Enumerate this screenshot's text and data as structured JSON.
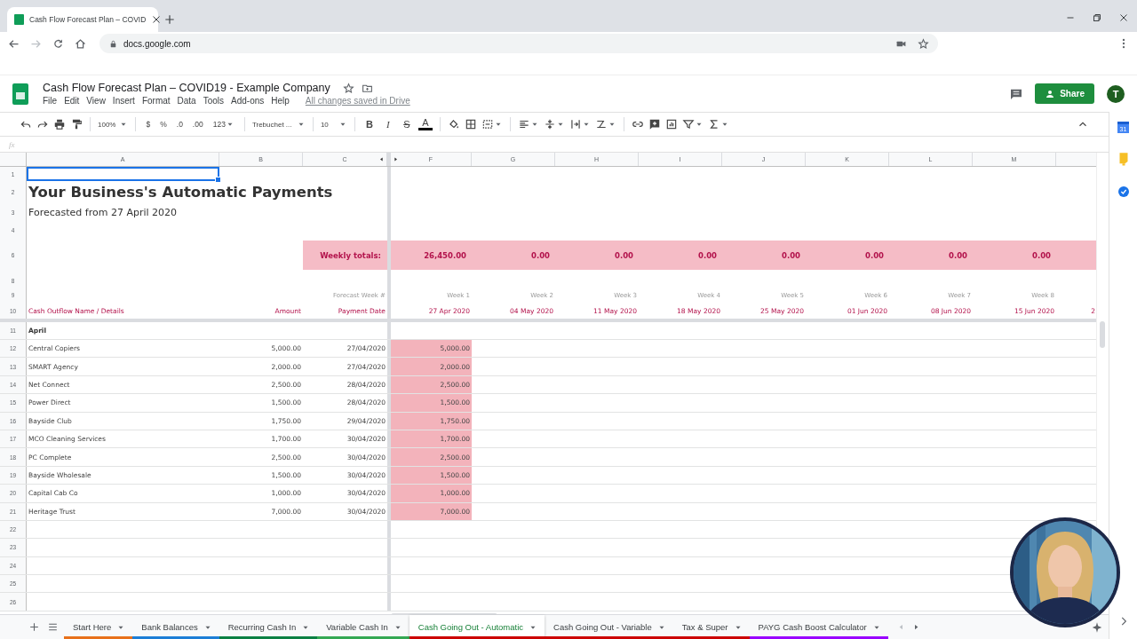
{
  "browser": {
    "tab_title": "Cash Flow Forecast Plan – COVID",
    "url": "docs.google.com"
  },
  "document": {
    "title": "Cash Flow Forecast Plan – COVID19 - Example Company",
    "menu": [
      "File",
      "Edit",
      "View",
      "Insert",
      "Format",
      "Data",
      "Tools",
      "Add-ons",
      "Help"
    ],
    "save_status": "All changes saved in Drive",
    "share_label": "Share",
    "avatar_initial": "T"
  },
  "toolbar": {
    "zoom": "100%",
    "format_buttons": [
      "$",
      "%",
      ".0",
      ".00",
      "123"
    ],
    "font": "Trebuchet ...",
    "font_size": "10",
    "style_buttons": [
      "B",
      "I",
      "S",
      "A"
    ]
  },
  "formula_bar": {
    "label": "fx"
  },
  "side_panel": {
    "calendar_day": "31"
  },
  "column_letters": [
    "A",
    "B",
    "C",
    "F",
    "G",
    "H",
    "I",
    "J",
    "K",
    "L",
    "M"
  ],
  "grid_rows": [
    {
      "number": "1",
      "kind": "blank",
      "selected": true
    },
    {
      "number": "2",
      "kind": "title",
      "text": "Your Business's Automatic Payments"
    },
    {
      "number": "3",
      "kind": "subtitle",
      "text": "Forecasted from 27 April 2020"
    },
    {
      "number": "4",
      "kind": "blank"
    },
    {
      "kind": "spacer"
    },
    {
      "number": "6",
      "kind": "totals",
      "label": "Weekly totals:",
      "values": [
        "26,450.00",
        "0.00",
        "0.00",
        "0.00",
        "0.00",
        "0.00",
        "0.00",
        "0.00"
      ]
    },
    {
      "kind": "spacer"
    },
    {
      "number": "8",
      "kind": "blank"
    },
    {
      "number": "9",
      "kind": "week_numbers",
      "label": "Forecast Week #",
      "values": [
        "Week 1",
        "Week 2",
        "Week 3",
        "Week 4",
        "Week 5",
        "Week 6",
        "Week 7",
        "Week 8"
      ]
    },
    {
      "number": "10",
      "kind": "headers",
      "name": "Cash Outflow Name / Details",
      "amount": "Amount",
      "date": "Payment Date",
      "values": [
        "27 Apr 2020",
        "04 May 2020",
        "11 May 2020",
        "18 May 2020",
        "25 May 2020",
        "01 Jun 2020",
        "08 Jun 2020",
        "15 Jun 2020",
        "2"
      ]
    },
    {
      "number": "11",
      "kind": "section",
      "name": "April"
    },
    {
      "number": "12",
      "kind": "payment",
      "name": "Central Copiers",
      "amount": "5,000.00",
      "date": "27/04/2020",
      "week_1": "5,000.00"
    },
    {
      "number": "13",
      "kind": "payment",
      "name": "SMART Agency",
      "amount": "2,000.00",
      "date": "27/04/2020",
      "week_1": "2,000.00"
    },
    {
      "number": "14",
      "kind": "payment",
      "name": "Net Connect",
      "amount": "2,500.00",
      "date": "28/04/2020",
      "week_1": "2,500.00"
    },
    {
      "number": "15",
      "kind": "payment",
      "name": "Power Direct",
      "amount": "1,500.00",
      "date": "28/04/2020",
      "week_1": "1,500.00"
    },
    {
      "number": "16",
      "kind": "payment",
      "name": "Bayside Club",
      "amount": "1,750.00",
      "date": "29/04/2020",
      "week_1": "1,750.00"
    },
    {
      "number": "17",
      "kind": "payment",
      "name": "MCO Cleaning Services",
      "amount": "1,700.00",
      "date": "30/04/2020",
      "week_1": "1,700.00"
    },
    {
      "number": "18",
      "kind": "payment",
      "name": "PC Complete",
      "amount": "2,500.00",
      "date": "30/04/2020",
      "week_1": "2,500.00"
    },
    {
      "number": "19",
      "kind": "payment",
      "name": "Bayside Wholesale",
      "amount": "1,500.00",
      "date": "30/04/2020",
      "week_1": "1,500.00"
    },
    {
      "number": "20",
      "kind": "payment",
      "name": "Capital Cab Co",
      "amount": "1,000.00",
      "date": "30/04/2020",
      "week_1": "1,000.00"
    },
    {
      "number": "21",
      "kind": "payment",
      "name": "Heritage Trust",
      "amount": "7,000.00",
      "date": "30/04/2020",
      "week_1": "7,000.00"
    },
    {
      "number": "22",
      "kind": "empty"
    },
    {
      "number": "23",
      "kind": "empty"
    },
    {
      "number": "24",
      "kind": "empty"
    },
    {
      "number": "25",
      "kind": "empty"
    },
    {
      "number": "26",
      "kind": "empty"
    }
  ],
  "sheet_tabs": [
    {
      "label": "Start Here",
      "color": "#e8711a",
      "selected": false
    },
    {
      "label": "Bank Balances",
      "color": "#1c7ed6",
      "selected": false
    },
    {
      "label": "Recurring Cash In",
      "color": "#0b8043",
      "selected": false
    },
    {
      "label": "Variable Cash In",
      "color": "#34a853",
      "selected": false
    },
    {
      "label": "Cash Going Out - Automatic",
      "color": "#cc0000",
      "selected": true
    },
    {
      "label": "Cash Going Out - Variable",
      "color": "#cc0000",
      "selected": false
    },
    {
      "label": "Tax & Super",
      "color": "#cc0000",
      "selected": false
    },
    {
      "label": "PAYG Cash Boost Calculator",
      "color": "#9900ff",
      "selected": false
    }
  ]
}
